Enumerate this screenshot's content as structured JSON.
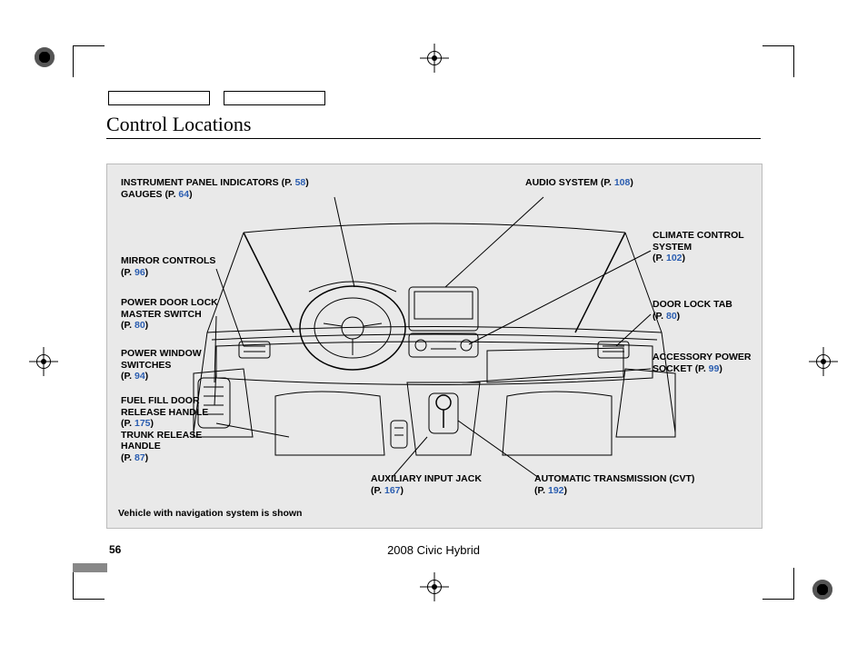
{
  "page": {
    "title": "Control Locations",
    "number": "56",
    "footer": "2008  Civic  Hybrid",
    "note": "Vehicle with navigation system is shown"
  },
  "callouts": {
    "top_instrument": {
      "label": "INSTRUMENT PANEL INDICATORS",
      "pg": "58"
    },
    "top_gauges": {
      "label": "GAUGES",
      "pg": "64"
    },
    "top_audio": {
      "label": "AUDIO SYSTEM",
      "pg": "108"
    },
    "l_mirror": {
      "label": "MIRROR CONTROLS",
      "pg": "96"
    },
    "l_powerlock": {
      "label": "POWER DOOR LOCK MASTER SWITCH",
      "pg": "80"
    },
    "l_powerwin": {
      "label": "POWER WINDOW SWITCHES",
      "pg": "94"
    },
    "l_fuel": {
      "label": "FUEL FILL DOOR RELEASE HANDLE",
      "pg": "175"
    },
    "l_trunk": {
      "label": "TRUNK RELEASE HANDLE",
      "pg": "87"
    },
    "r_climate": {
      "label": "CLIMATE CONTROL SYSTEM",
      "pg": "102"
    },
    "r_doorlock": {
      "label": "DOOR LOCK TAB",
      "pg": "80"
    },
    "r_accpower": {
      "label": "ACCESSORY POWER SOCKET",
      "pg": "99"
    },
    "b_aux": {
      "label": "AUXILIARY INPUT JACK",
      "pg": "167"
    },
    "b_auto": {
      "label": "AUTOMATIC TRANSMISSION (CVT)",
      "pg": "192"
    }
  }
}
